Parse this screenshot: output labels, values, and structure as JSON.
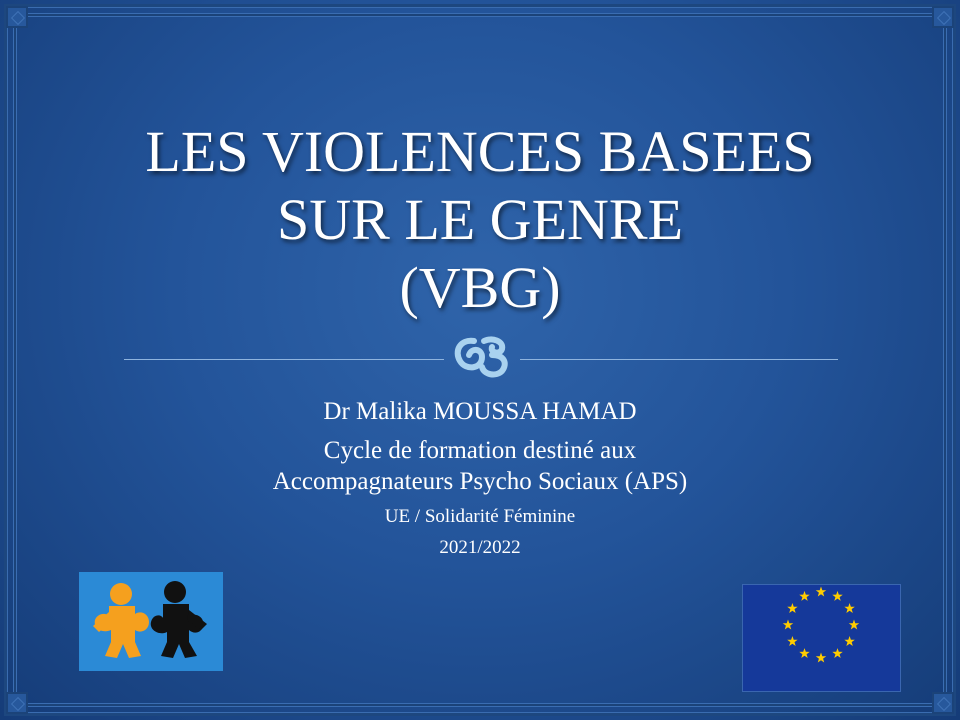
{
  "slide": {
    "title_lines": [
      "LES VIOLENCES BASEES",
      "SUR LE GENRE",
      "(VBG)"
    ],
    "author": "Dr Malika MOUSSA HAMAD",
    "course_line1": "Cycle de formation destiné aux",
    "course_line2": "Accompagnateurs Psycho Sociaux (APS)",
    "partners": "UE / Solidarité Féminine",
    "year": "2021/2022"
  },
  "icons": {
    "divider_ornament": "scroll-flourish-icon",
    "left_logo": "puzzle-people-logo",
    "right_logo": "eu-flag"
  },
  "colors": {
    "background": "#23549a",
    "text": "#ffffff",
    "ornament": "#a9d2ef",
    "puzzle_orange": "#f5a01e",
    "puzzle_black": "#111111",
    "logo_bg": "#2b8ad6",
    "eu_blue": "#15399a",
    "eu_star": "#ffcc00"
  }
}
